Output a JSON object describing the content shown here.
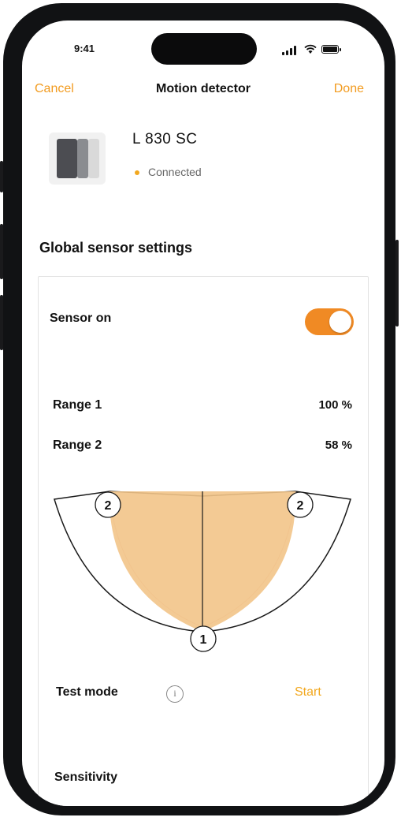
{
  "status_bar": {
    "time": "9:41"
  },
  "nav": {
    "cancel_label": "Cancel",
    "title": "Motion detector",
    "done_label": "Done"
  },
  "device": {
    "name": "L 830 SC",
    "status": "Connected"
  },
  "section_title": "Global sensor settings",
  "settings": {
    "sensor_on_label": "Sensor on",
    "sensor_on": true,
    "range1_label": "Range 1",
    "range1_value": "100 %",
    "range2_label": "Range 2",
    "range2_value": "58 %",
    "diagram_marker_2": "2",
    "diagram_marker_1": "1",
    "test_mode_label": "Test mode",
    "info_symbol": "i",
    "start_label": "Start",
    "sensitivity_label": "Sensitivity"
  },
  "colors": {
    "accent": "#f29b1f",
    "toggle": "#f08a24",
    "range_fill": "#f2c488",
    "status_dot": "#f2a81f"
  }
}
